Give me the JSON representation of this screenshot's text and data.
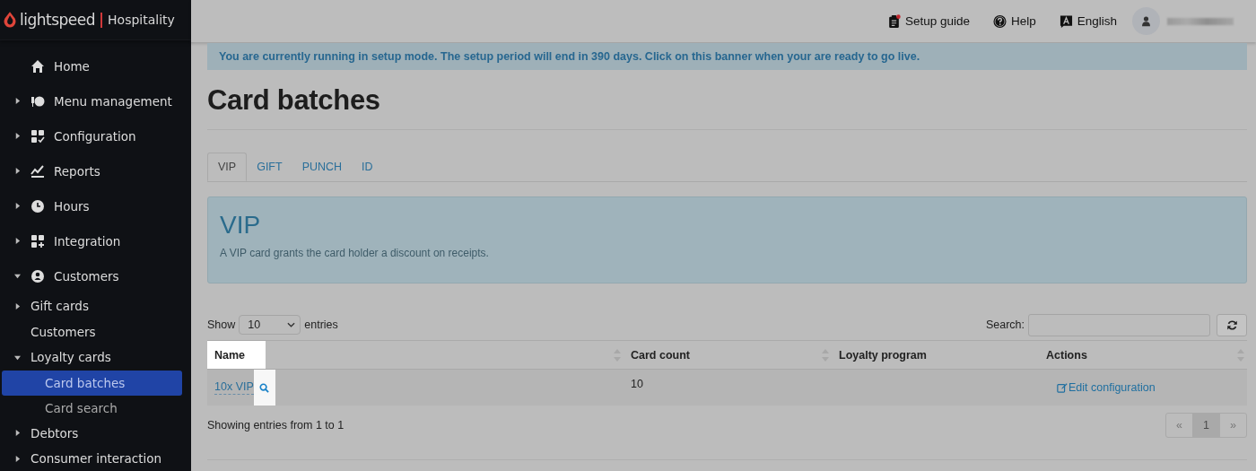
{
  "brand": {
    "name": "lightspeed",
    "product": "Hospitality"
  },
  "sidebar": {
    "items": [
      {
        "label": "Home",
        "selected": false
      },
      {
        "label": "Menu management",
        "expanded": false,
        "selected": false
      },
      {
        "label": "Configuration",
        "expanded": false,
        "selected": false
      },
      {
        "label": "Reports",
        "expanded": false,
        "selected": false
      },
      {
        "label": "Hours",
        "expanded": false,
        "selected": false
      },
      {
        "label": "Integration",
        "expanded": false,
        "selected": false
      },
      {
        "label": "Customers",
        "expanded": true,
        "selected": false,
        "children": [
          {
            "label": "Gift cards",
            "expanded": false,
            "selected": false
          },
          {
            "label": "Customers",
            "selected": false
          },
          {
            "label": "Loyalty cards",
            "expanded": true,
            "selected": false,
            "children": [
              {
                "label": "Card batches",
                "selected": true
              },
              {
                "label": "Card search",
                "selected": false
              }
            ]
          },
          {
            "label": "Debtors",
            "expanded": false,
            "selected": false
          },
          {
            "label": "Consumer interaction",
            "expanded": false,
            "selected": false
          }
        ]
      }
    ]
  },
  "topbar": {
    "setup_guide": "Setup guide",
    "setup_guide_notification": true,
    "help": "Help",
    "language": "English"
  },
  "banner": "You are currently running in setup mode. The setup period will end in 390 days. Click on this banner when your are ready to go live.",
  "page_title": "Card batches",
  "tabs": [
    {
      "label": "VIP",
      "selected": true
    },
    {
      "label": "GIFT",
      "selected": false
    },
    {
      "label": "PUNCH",
      "selected": false
    },
    {
      "label": "ID",
      "selected": false
    }
  ],
  "info_box": {
    "heading": "VIP",
    "text": "A VIP card grants the card holder a discount on receipts."
  },
  "table_controls": {
    "show_label": "Show",
    "page_size": "10",
    "entries_label": "entries",
    "search_label": "Search:"
  },
  "table": {
    "columns": [
      {
        "label": "Name",
        "sortable": true,
        "highlighted": true
      },
      {
        "label": "Card count",
        "sortable": true,
        "highlighted": false
      },
      {
        "label": "Loyalty program",
        "sortable": false,
        "highlighted": false
      },
      {
        "label": "Actions",
        "sortable": true,
        "highlighted": false
      }
    ],
    "rows": [
      {
        "name": "10x VIP",
        "search_highlighted": true,
        "card_count": "10",
        "action": "Edit configuration"
      }
    ]
  },
  "footer": {
    "summary": "Showing entries from 1 to 1",
    "pagination": [
      {
        "label": "«",
        "selected": false
      },
      {
        "label": "1",
        "selected": true
      },
      {
        "label": "»",
        "selected": false
      }
    ]
  }
}
